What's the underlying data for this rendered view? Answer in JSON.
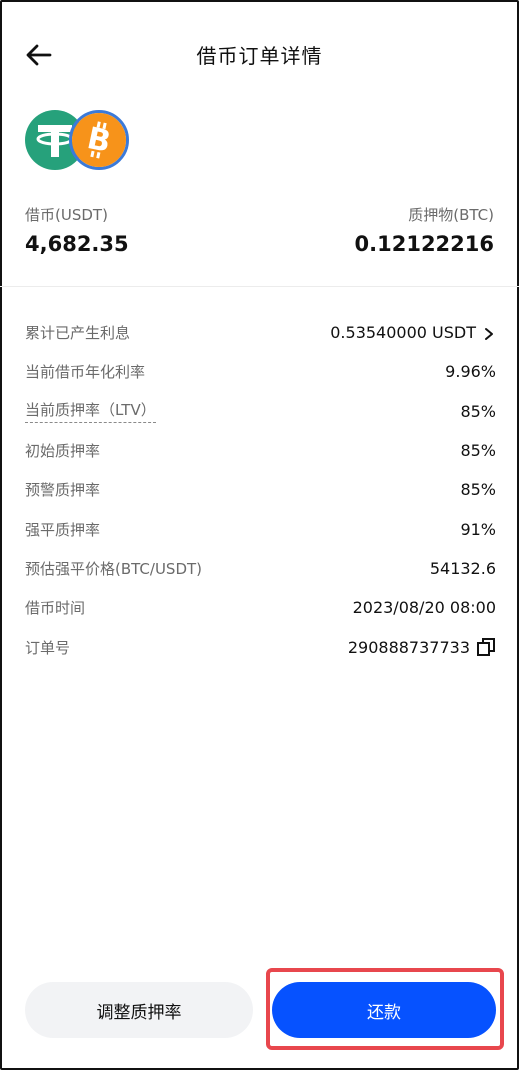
{
  "header": {
    "title": "借币订单详情"
  },
  "coins": {
    "borrow_icon": "usdt-icon",
    "collateral_icon": "btc-icon",
    "usdt_color": "#26a17b",
    "btc_color": "#f7931a"
  },
  "summary": {
    "borrow_label": "借币(USDT)",
    "borrow_value": "4,682.35",
    "collateral_label": "质押物(BTC)",
    "collateral_value": "0.12122216"
  },
  "details": [
    {
      "label": "累计已产生利息",
      "value": "0.53540000 USDT"
    },
    {
      "label": "当前借币年化利率",
      "value": "9.96%"
    },
    {
      "label": "当前质押率（LTV）",
      "value": "85%"
    },
    {
      "label": "初始质押率",
      "value": "85%"
    },
    {
      "label": "预警质押率",
      "value": "85%"
    },
    {
      "label": "强平质押率",
      "value": "91%"
    },
    {
      "label": "预估强平价格(BTC/USDT)",
      "value": "54132.6"
    },
    {
      "label": "借币时间",
      "value": "2023/08/20 08:00"
    },
    {
      "label": "订单号",
      "value": "290888737733"
    }
  ],
  "actions": {
    "adjust_label": "调整质押率",
    "repay_label": "还款"
  },
  "colors": {
    "primary": "#0652ff",
    "highlight": "#e8474d"
  }
}
